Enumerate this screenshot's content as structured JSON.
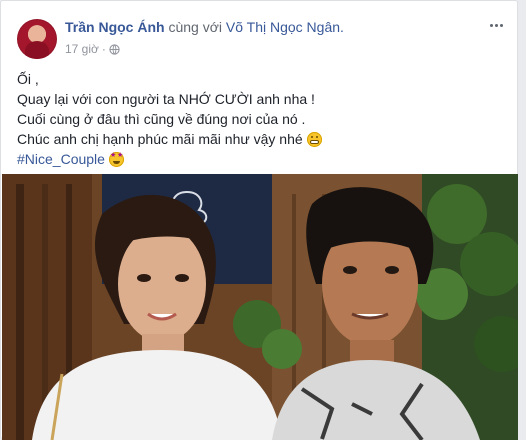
{
  "post": {
    "author": "Trần Ngọc Ánh",
    "with_text": "cùng với",
    "tagged_user": "Võ Thị Ngọc Ngân.",
    "timestamp": "17 giờ",
    "privacy_icon": "globe-icon",
    "more_icon": "more-options-icon"
  },
  "content": {
    "line1": "Ối ,",
    "line2": "Quay lại với con người ta NHỚ CƯỜI anh nha !",
    "line3": "Cuối cùng ở đâu thì cũng về đúng nơi của nó .",
    "line4": "Chúc anh chị hạnh phúc mãi mãi như vậy nhé",
    "hashtag": "#Nice_Couple"
  },
  "colors": {
    "link": "#385898",
    "text": "#1d2129",
    "meta": "#90949c",
    "background": "#e9ebee"
  }
}
